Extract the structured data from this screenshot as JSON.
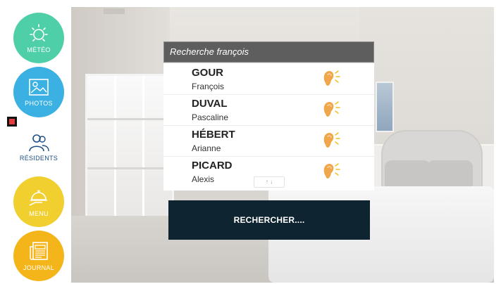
{
  "sidebar": {
    "items": [
      {
        "label": "MÉTÉO",
        "icon": "sun-icon"
      },
      {
        "label": "PHOTOS",
        "icon": "image-icon"
      },
      {
        "label": "RÉSIDENTS",
        "icon": "people-icon"
      },
      {
        "label": "MENU",
        "icon": "cloche-icon"
      },
      {
        "label": "JOURNAL",
        "icon": "newspaper-icon"
      }
    ]
  },
  "panel": {
    "title": "Recherche françois",
    "residents": [
      {
        "last_name": "GOUR",
        "first_name": "François"
      },
      {
        "last_name": "DUVAL",
        "first_name": "Pascaline"
      },
      {
        "last_name": "HÉBERT",
        "first_name": "Arianne"
      },
      {
        "last_name": "PICARD",
        "first_name": "Alexis"
      }
    ],
    "scroll_hint": "↑ ↓"
  },
  "search_button": {
    "label": "RECHERCHER...."
  },
  "colors": {
    "meteo": "#4fcfa8",
    "photos": "#3ab0e3",
    "residents_text": "#1c4f86",
    "menu": "#f0cf2f",
    "journal": "#f4b51b",
    "panel_header": "#5e5e5e",
    "search_button": "#0e2431",
    "ear": "#f0a64a"
  }
}
